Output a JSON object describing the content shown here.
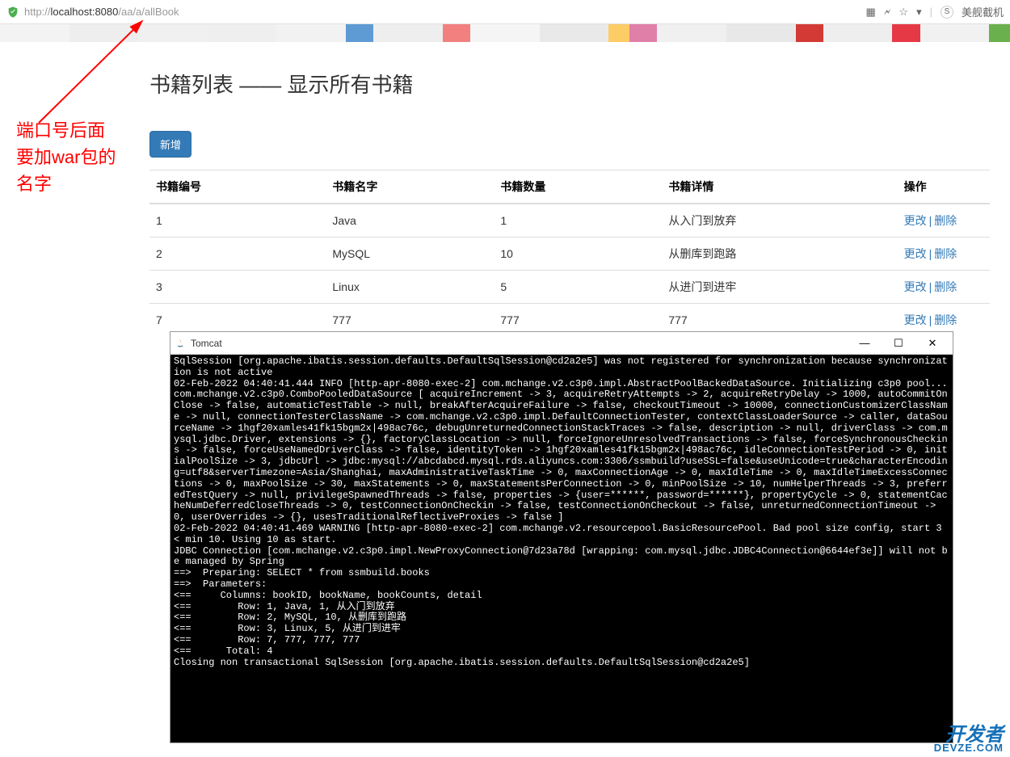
{
  "url": {
    "prefix": "http://",
    "host": "localhost:8080",
    "path": "/aa/a/allBook"
  },
  "toolbarRight": {
    "meishuo": "美舰截机"
  },
  "annotation": {
    "line1": "端口号后面",
    "line2": "要加war包的",
    "line3": "名字"
  },
  "pageTitle": "书籍列表 —— 显示所有书籍",
  "addButton": "新增",
  "headers": {
    "id": "书籍编号",
    "name": "书籍名字",
    "count": "书籍数量",
    "detail": "书籍详情",
    "ops": "操作"
  },
  "rows": [
    {
      "id": "1",
      "name": "Java",
      "count": "1",
      "detail": "从入门到放弃"
    },
    {
      "id": "2",
      "name": "MySQL",
      "count": "10",
      "detail": "从删库到跑路"
    },
    {
      "id": "3",
      "name": "Linux",
      "count": "5",
      "detail": "从进门到进牢"
    },
    {
      "id": "7",
      "name": "777",
      "count": "777",
      "detail": "777"
    }
  ],
  "opLabels": {
    "edit": "更改",
    "del": "删除"
  },
  "terminal": {
    "title": "Tomcat",
    "log": "SqlSession [org.apache.ibatis.session.defaults.DefaultSqlSession@cd2a2e5] was not registered for synchronization because synchronization is not active\n02-Feb-2022 04:40:41.444 INFO [http-apr-8080-exec-2] com.mchange.v2.c3p0.impl.AbstractPoolBackedDataSource. Initializing c3p0 pool... com.mchange.v2.c3p0.ComboPooledDataSource [ acquireIncrement -> 3, acquireRetryAttempts -> 2, acquireRetryDelay -> 1000, autoCommitOnClose -> false, automaticTestTable -> null, breakAfterAcquireFailure -> false, checkoutTimeout -> 10000, connectionCustomizerClassName -> null, connectionTesterClassName -> com.mchange.v2.c3p0.impl.DefaultConnectionTester, contextClassLoaderSource -> caller, dataSourceName -> 1hgf20xamles41fk15bgm2x|498ac76c, debugUnreturnedConnectionStackTraces -> false, description -> null, driverClass -> com.mysql.jdbc.Driver, extensions -> {}, factoryClassLocation -> null, forceIgnoreUnresolvedTransactions -> false, forceSynchronousCheckins -> false, forceUseNamedDriverClass -> false, identityToken -> 1hgf20xamles41fk15bgm2x|498ac76c, idleConnectionTestPeriod -> 0, initialPoolSize -> 3, jdbcUrl -> jdbc:mysql://abcdabcd.mysql.rds.aliyuncs.com:3306/ssmbuild?useSSL=false&useUnicode=true&characterEncoding=utf8&serverTimezone=Asia/Shanghai, maxAdministrativeTaskTime -> 0, maxConnectionAge -> 0, maxIdleTime -> 0, maxIdleTimeExcessConnections -> 0, maxPoolSize -> 30, maxStatements -> 0, maxStatementsPerConnection -> 0, minPoolSize -> 10, numHelperThreads -> 3, preferredTestQuery -> null, privilegeSpawnedThreads -> false, properties -> {user=******, password=******}, propertyCycle -> 0, statementCacheNumDeferredCloseThreads -> 0, testConnectionOnCheckin -> false, testConnectionOnCheckout -> false, unreturnedConnectionTimeout -> 0, userOverrides -> {}, usesTraditionalReflectiveProxies -> false ]\n02-Feb-2022 04:40:41.469 WARNING [http-apr-8080-exec-2] com.mchange.v2.resourcepool.BasicResourcePool. Bad pool size config, start 3 < min 10. Using 10 as start.\nJDBC Connection [com.mchange.v2.c3p0.impl.NewProxyConnection@7d23a78d [wrapping: com.mysql.jdbc.JDBC4Connection@6644ef3e]] will not be managed by Spring\n==>  Preparing: SELECT * from ssmbuild.books\n==>  Parameters: \n<==     Columns: bookID, bookName, bookCounts, detail\n<==        Row: 1, Java, 1, 从入门到放弃\n<==        Row: 2, MySQL, 10, 从删库到跑路\n<==        Row: 3, Linux, 5, 从进门到进牢\n<==        Row: 7, 777, 777, 777\n<==      Total: 4\nClosing non transactional SqlSession [org.apache.ibatis.session.defaults.DefaultSqlSession@cd2a2e5]"
  },
  "watermark": {
    "main": "开发者",
    "sub": "DEVZE.COM"
  }
}
